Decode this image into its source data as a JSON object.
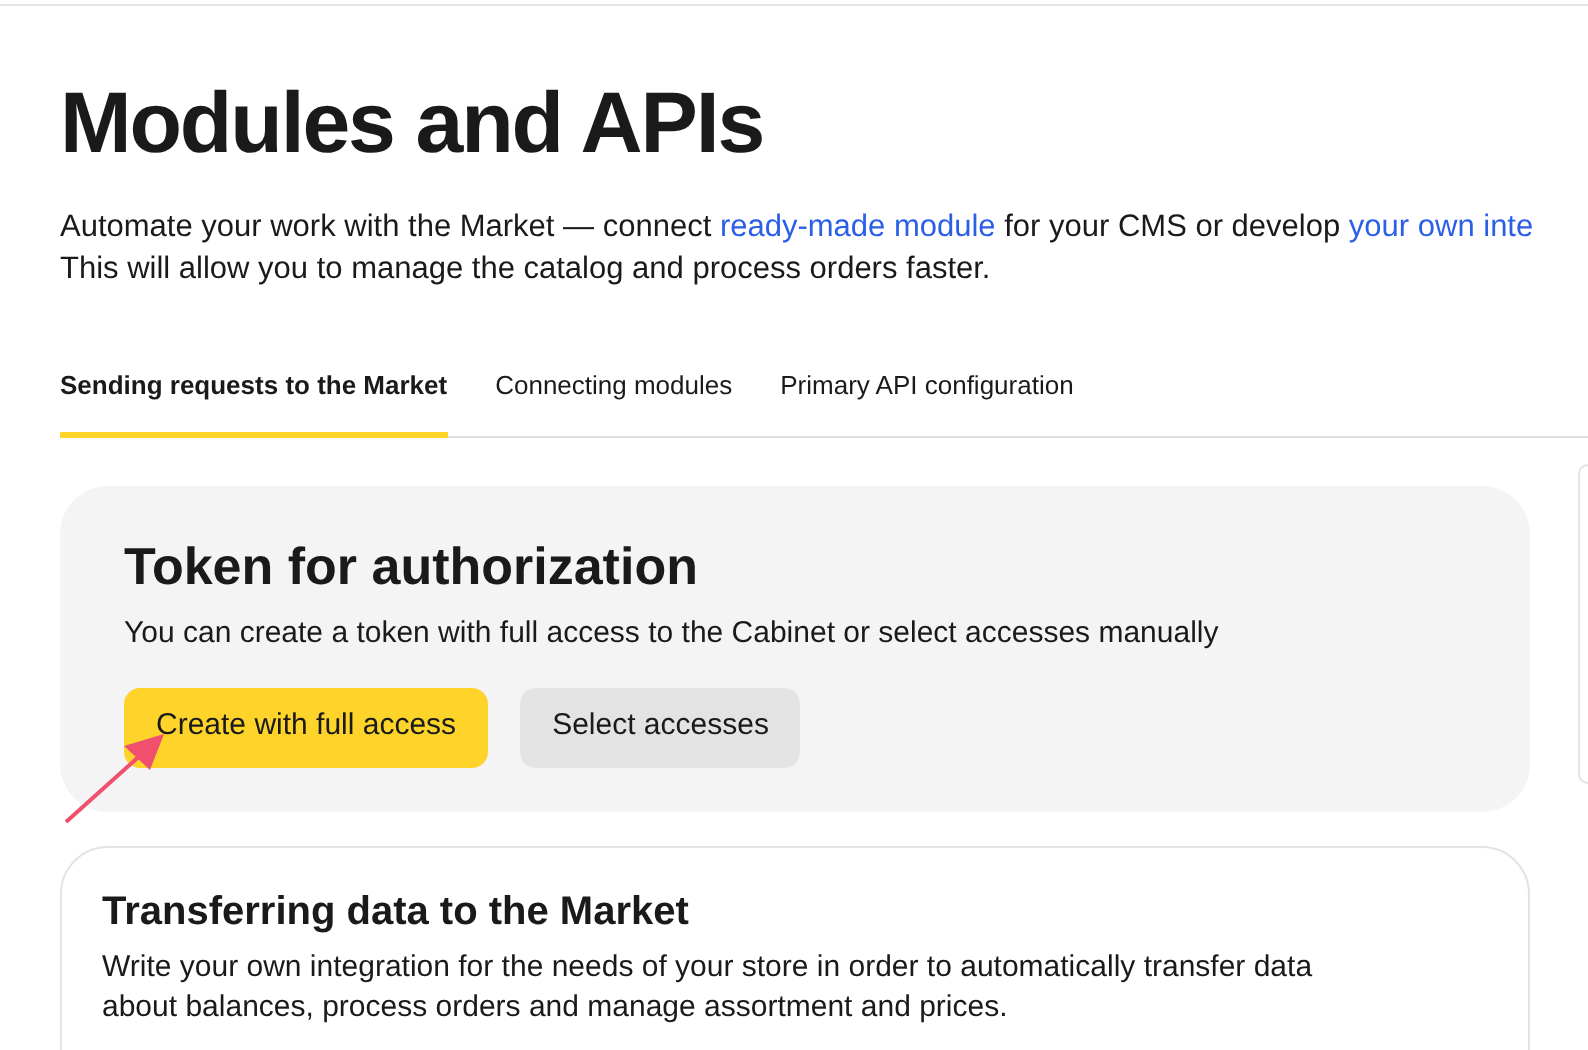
{
  "title": "Modules and APIs",
  "description": [
    {
      "kind": "text",
      "text": "Automate your work with the Market — connect "
    },
    {
      "kind": "link",
      "text": "ready-made module"
    },
    {
      "kind": "text",
      "text": " for your CMS or develop "
    },
    {
      "kind": "link",
      "text": "your own inte"
    },
    {
      "kind": "break"
    },
    {
      "kind": "text",
      "text": "This will allow you to manage the catalog and process orders faster."
    }
  ],
  "tabs": [
    {
      "label": "Sending requests to the Market",
      "selected": true
    },
    {
      "label": "Connecting modules",
      "selected": false
    },
    {
      "label": "Primary API configuration",
      "selected": false
    }
  ],
  "token_card": {
    "title": "Token for authorization",
    "text": "You can create a token with full access to the Cabinet or select accesses manually",
    "buttons": [
      {
        "label": "Create with full access",
        "kind": "primary"
      },
      {
        "label": "Select accesses",
        "kind": "secondary"
      }
    ]
  },
  "transfer_card": {
    "title": "Transferring data to the Market",
    "text": "Write your own integration for the needs of your store in order to automatically transfer data about balances, process orders and manage assortment and prices."
  }
}
